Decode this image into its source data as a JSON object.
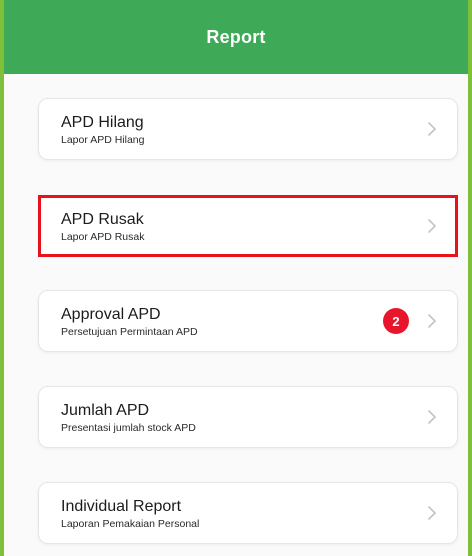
{
  "header": {
    "title": "Report"
  },
  "menu": {
    "items": [
      {
        "title": "APD Hilang",
        "subtitle": "Lapor APD Hilang",
        "chevron_icon": "chevron-right-icon"
      },
      {
        "title": "APD Rusak",
        "subtitle": "Lapor APD Rusak",
        "chevron_icon": "chevron-right-icon",
        "highlighted": true
      },
      {
        "title": "Approval APD",
        "subtitle": "Persetujuan Permintaan APD",
        "badge": "2",
        "chevron_icon": "chevron-right-icon"
      },
      {
        "title": "Jumlah APD",
        "subtitle": "Presentasi jumlah stock APD",
        "chevron_icon": "chevron-right-icon"
      },
      {
        "title": "Individual Report",
        "subtitle": "Laporan Pemakaian Personal",
        "chevron_icon": "chevron-right-icon"
      }
    ]
  },
  "colors": {
    "header_bg": "#3ea956",
    "frame_border": "#7fbf3a",
    "highlight_border": "#e8121d",
    "badge_bg": "#e8162c"
  }
}
